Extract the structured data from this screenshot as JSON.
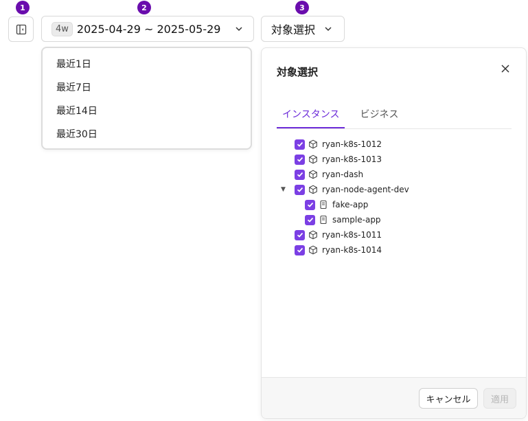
{
  "badges": [
    "1",
    "2",
    "3"
  ],
  "date_picker": {
    "range_tag": "4w",
    "value": "2025-04-29 ~ 2025-05-29"
  },
  "date_options": [
    "最近1日",
    "最近7日",
    "最近14日",
    "最近30日"
  ],
  "target_select": {
    "label": "対象選択"
  },
  "panel": {
    "title": "対象選択",
    "tabs": [
      {
        "label": "インスタンス",
        "active": true
      },
      {
        "label": "ビジネス",
        "active": false
      }
    ],
    "tree": [
      {
        "label": "ryan-k8s-1012",
        "icon": "box-icon",
        "checked": true,
        "level": 0
      },
      {
        "label": "ryan-k8s-1013",
        "icon": "box-icon",
        "checked": true,
        "level": 0
      },
      {
        "label": "ryan-dash",
        "icon": "box-icon",
        "checked": true,
        "level": 0
      },
      {
        "label": "ryan-node-agent-dev",
        "icon": "box-icon",
        "checked": true,
        "level": 0,
        "expanded": true
      },
      {
        "label": "fake-app",
        "icon": "app-icon",
        "checked": true,
        "level": 1
      },
      {
        "label": "sample-app",
        "icon": "app-icon",
        "checked": true,
        "level": 1
      },
      {
        "label": "ryan-k8s-1011",
        "icon": "box-icon",
        "checked": true,
        "level": 0
      },
      {
        "label": "ryan-k8s-1014",
        "icon": "box-icon",
        "checked": true,
        "level": 0
      }
    ],
    "cancel_label": "キャンセル",
    "apply_label": "適用"
  },
  "colors": {
    "accent": "#7b3fe4",
    "badge": "#6a0dad",
    "tab_active": "#6c2bd9"
  }
}
